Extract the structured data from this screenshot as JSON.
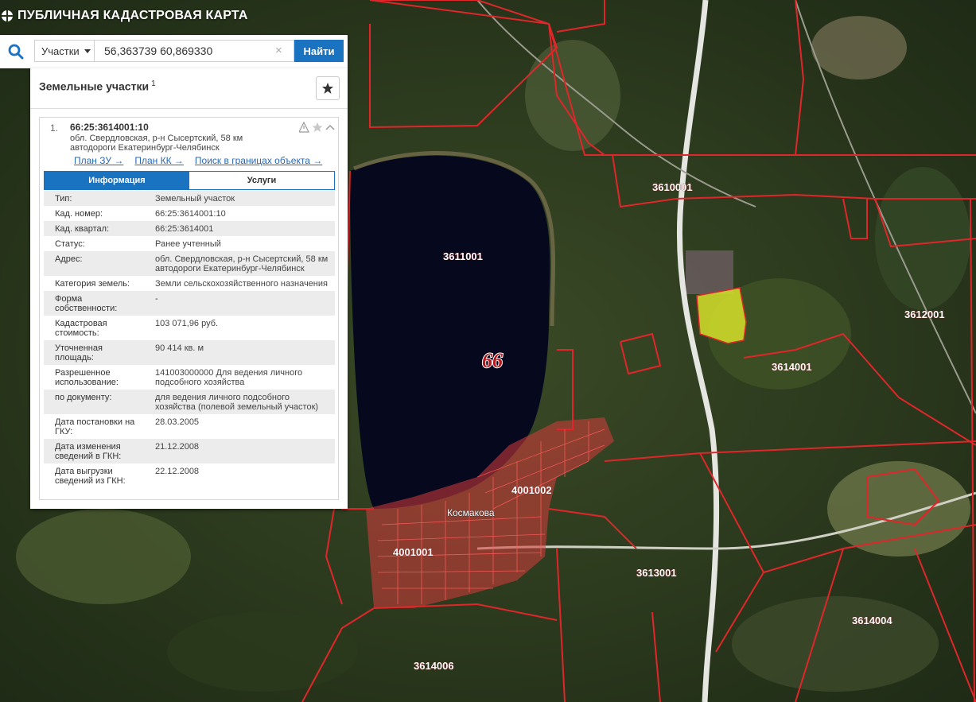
{
  "app": {
    "title": "ПУБЛИЧНАЯ КАДАСТРОВАЯ КАРТА"
  },
  "search": {
    "type_label": "Участки",
    "query": "56,363739 60,869330",
    "clear_symbol": "×",
    "find_label": "Найти"
  },
  "panel": {
    "title": "Земельные участки",
    "count": "1",
    "item": {
      "num": "1.",
      "cad_number": "66:25:3614001:10",
      "address": "обл. Свердловская, р-н Сысертский, 58 км автодороги Екатеринбург-Челябинск",
      "links": [
        "План ЗУ →",
        "План КК →",
        "Поиск в границах объекта →"
      ],
      "tabs": [
        "Информация",
        "Услуги"
      ],
      "rows": [
        {
          "k": "Тип:",
          "v": "Земельный участок"
        },
        {
          "k": "Кад. номер:",
          "v": "66:25:3614001:10"
        },
        {
          "k": "Кад. квартал:",
          "v": "66:25:3614001"
        },
        {
          "k": "Статус:",
          "v": "Ранее учтенный"
        },
        {
          "k": "Адрес:",
          "v": "обл. Свердловская, р-н Сысертский, 58 км автодороги Екатеринбург-Челябинск"
        },
        {
          "k": "Категория земель:",
          "v": "Земли сельскохозяйственного назначения"
        },
        {
          "k": "Форма собственности:",
          "v": "-"
        },
        {
          "k": "Кадастровая стоимость:",
          "v": "103 071,96 руб."
        },
        {
          "k": "Уточненная площадь:",
          "v": "90 414 кв. м"
        },
        {
          "k": "Разрешенное использование:",
          "v": "141003000000 Для ведения личного подсобного хозяйства"
        },
        {
          "k": "по документу:",
          "v": "для ведения личного подсобного хозяйства (полевой земельный участок)"
        },
        {
          "k": "Дата постановки на ГКУ:",
          "v": "28.03.2005"
        },
        {
          "k": "Дата изменения сведений в ГКН:",
          "v": "21.12.2008"
        },
        {
          "k": "Дата выгрузки сведений из ГКН:",
          "v": "22.12.2008"
        }
      ]
    }
  },
  "map": {
    "region_label": "66",
    "village_label": "Космакова",
    "quarter_labels": [
      "3611001",
      "3610001",
      "3612001",
      "3614001",
      "4001002",
      "4001001",
      "3613001",
      "3614004",
      "3614006"
    ]
  },
  "colors": {
    "accent": "#1a73c0",
    "boundary": "#e0262a",
    "highlight": "#d6e22a",
    "lake": "#06081e"
  }
}
